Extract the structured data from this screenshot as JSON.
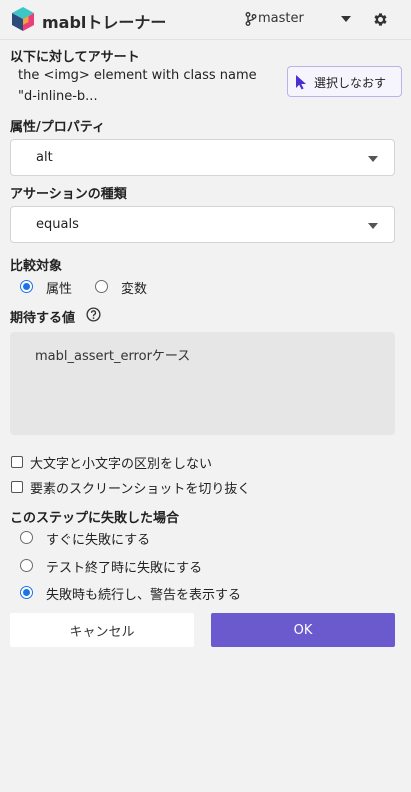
{
  "header": {
    "brand": "mablトレーナー",
    "branch": "master",
    "icons": {
      "logo": "mabl-logo-icon",
      "branch": "git-branch-icon",
      "caret": "chevron-down-icon",
      "settings": "gear-icon"
    }
  },
  "assert_target": {
    "heading": "以下に対してアサート",
    "line1": "the <img> element with class name",
    "line2": "\"d-inline-b...",
    "reselect_label": "選択しなおす"
  },
  "attribute": {
    "heading": "属性/プロパティ",
    "value": "alt"
  },
  "assertion_type": {
    "heading": "アサーションの種類",
    "value": "equals"
  },
  "compare": {
    "heading": "比較対象",
    "options": [
      {
        "label": "属性",
        "selected": true
      },
      {
        "label": "変数",
        "selected": false
      }
    ]
  },
  "expected": {
    "heading": "期待する値",
    "value": "mabl_assert_errorケース"
  },
  "options": {
    "case_insensitive": {
      "label": "大文字と小文字の区別をしない",
      "checked": false
    },
    "crop_screenshot": {
      "label": "要素のスクリーンショットを切り抜く",
      "checked": false
    }
  },
  "failure": {
    "heading": "このステップに失敗した場合",
    "options": [
      {
        "label": "すぐに失敗にする",
        "selected": false
      },
      {
        "label": "テスト終了時に失敗にする",
        "selected": false
      },
      {
        "label": "失敗時も続行し、警告を表示する",
        "selected": true
      }
    ]
  },
  "actions": {
    "cancel": "キャンセル",
    "ok": "OK"
  },
  "colors": {
    "accent": "#6a5acd",
    "radio": "#1a73e8",
    "background": "#f2f2f2"
  }
}
